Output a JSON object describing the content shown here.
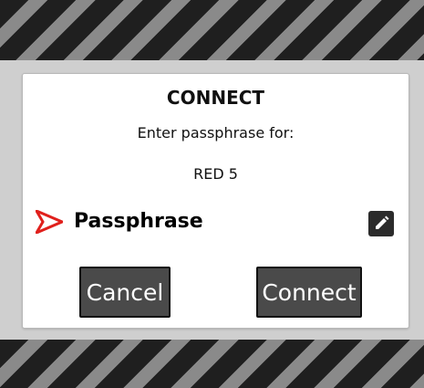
{
  "dialog": {
    "title": "CONNECT",
    "prompt": "Enter passphrase for:",
    "target": "RED 5",
    "field_label": "Passphrase",
    "cancel_label": "Cancel",
    "connect_label": "Connect"
  },
  "icons": {
    "field_marker": "red-chevron-arrow-icon",
    "edit": "pencil-icon"
  },
  "colors": {
    "accent": "#e0201c",
    "button_bg": "#4a4a4a",
    "hazard_dark": "#1f1f1f",
    "hazard_light": "#8a8a8a"
  }
}
